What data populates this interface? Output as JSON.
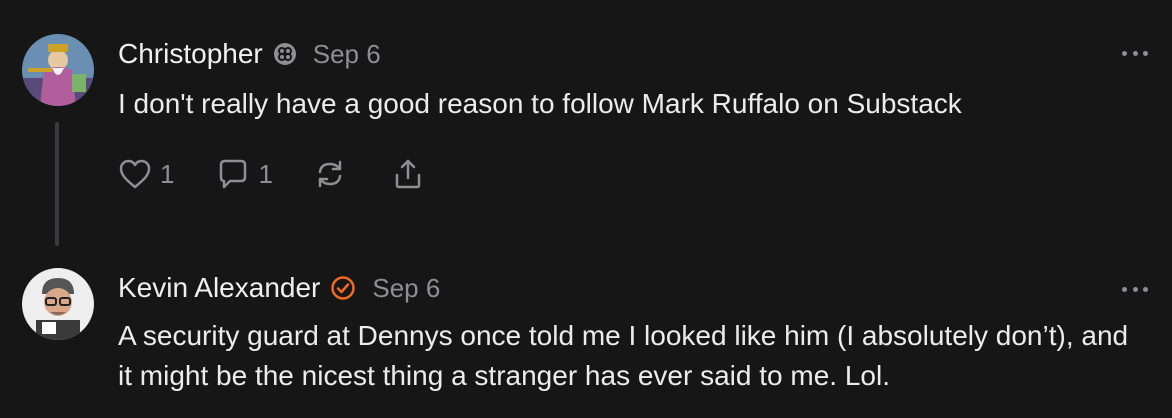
{
  "notes": [
    {
      "author": "Christopher",
      "badge_icon": "substack-founding-badge-icon",
      "date": "Sep 6",
      "text": "I don't really have a good reason to follow Mark Ruffalo on Substack",
      "likes": "1",
      "comments": "1",
      "more_icon": "ellipsis-icon"
    },
    {
      "author": "Kevin Alexander",
      "badge_icon": "verified-check-icon",
      "badge_color": "#f26a1b",
      "date": "Sep 6",
      "text": "A security guard at Dennys once told me I looked like him (I absolutely don’t), and it might be the nicest thing a stranger has ever said to me. Lol.",
      "more_icon": "ellipsis-icon"
    }
  ],
  "colors": {
    "background": "#161617",
    "text": "#ececec",
    "muted": "#8e8e93",
    "accent": "#f26a1b"
  }
}
